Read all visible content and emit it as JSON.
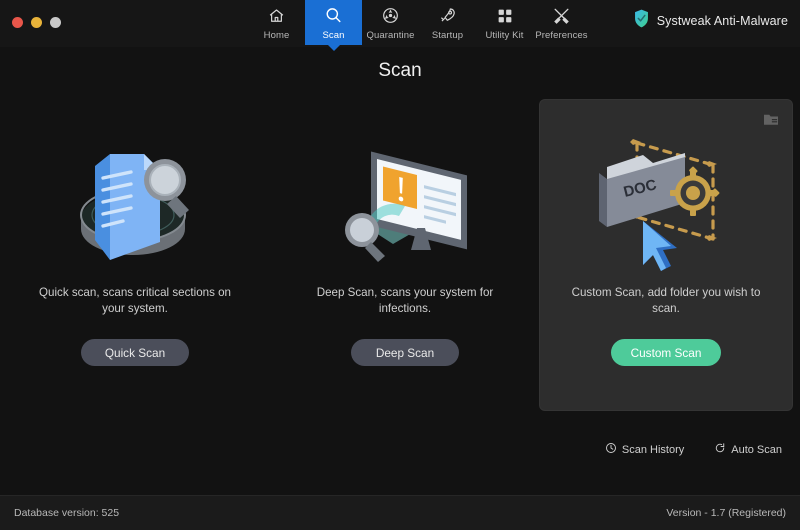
{
  "window": {
    "controls": [
      {
        "name": "close",
        "color": "#e8564a"
      },
      {
        "name": "minimize",
        "color": "#e8b33a"
      },
      {
        "name": "maximize",
        "color": "#c9c9c9"
      }
    ]
  },
  "nav": {
    "items": [
      {
        "label": "Home",
        "icon": "home-icon",
        "active": false
      },
      {
        "label": "Scan",
        "icon": "search-icon",
        "active": true
      },
      {
        "label": "Quarantine",
        "icon": "radiation-icon",
        "active": false
      },
      {
        "label": "Startup",
        "icon": "rocket-icon",
        "active": false
      },
      {
        "label": "Utility Kit",
        "icon": "grid-icon",
        "active": false
      },
      {
        "label": "Preferences",
        "icon": "tools-icon",
        "active": false
      }
    ],
    "active_color": "#1a6fd4"
  },
  "brand": {
    "name": "Systweak Anti-Malware",
    "icon": "shield-icon"
  },
  "page": {
    "title": "Scan"
  },
  "cards": [
    {
      "id": "quick-scan",
      "description": "Quick scan, scans critical sections on your system.",
      "button_label": "Quick Scan",
      "button_style": "gray",
      "illustration": "document-magnifier-illustration",
      "highlighted": false
    },
    {
      "id": "deep-scan",
      "description": "Deep Scan, scans your system for infections.",
      "button_label": "Deep Scan",
      "button_style": "gray",
      "illustration": "monitor-warning-magnifier-illustration",
      "highlighted": false
    },
    {
      "id": "custom-scan",
      "description": "Custom Scan, add folder you wish to scan.",
      "button_label": "Custom Scan",
      "button_style": "green",
      "illustration": "folder-gear-cursor-illustration",
      "highlighted": true,
      "corner_icon": "folder-icon"
    }
  ],
  "links": [
    {
      "label": "Scan History",
      "icon": "clock-icon"
    },
    {
      "label": "Auto Scan",
      "icon": "refresh-icon"
    }
  ],
  "footer": {
    "database": "Database version: 525",
    "version": "Version  -  1.7 (Registered)"
  },
  "colors": {
    "accent_blue": "#1a6fd4",
    "accent_green": "#4ecb9a",
    "button_gray": "#4b4e5a",
    "card_highlight_bg": "#2d2d2d",
    "window_bg": "#121212"
  }
}
